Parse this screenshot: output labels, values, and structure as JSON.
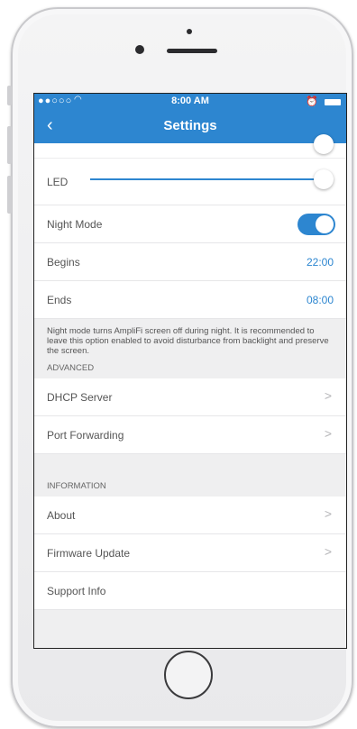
{
  "status": {
    "signal": "●●○○○",
    "time": "8:00 AM"
  },
  "nav": {
    "back": "‹",
    "title": "Settings"
  },
  "settings": {
    "led_label": "LED",
    "night_mode_label": "Night Mode",
    "night_mode_on": true,
    "begins_label": "Begins",
    "begins_value": "22:00",
    "ends_label": "Ends",
    "ends_value": "08:00",
    "note": "Night mode turns AmpliFi screen off during night. It is recommended to leave this option enabled to avoid disturbance from backlight and preserve the screen."
  },
  "advanced": {
    "header": "ADVANCED",
    "items": [
      {
        "label": "DHCP Server"
      },
      {
        "label": "Port Forwarding"
      }
    ]
  },
  "information": {
    "header": "INFORMATION",
    "items": [
      {
        "label": "About"
      },
      {
        "label": "Firmware Update"
      },
      {
        "label": "Support Info"
      }
    ]
  },
  "colors": {
    "accent": "#2d86d0",
    "background": "#efeff0"
  }
}
